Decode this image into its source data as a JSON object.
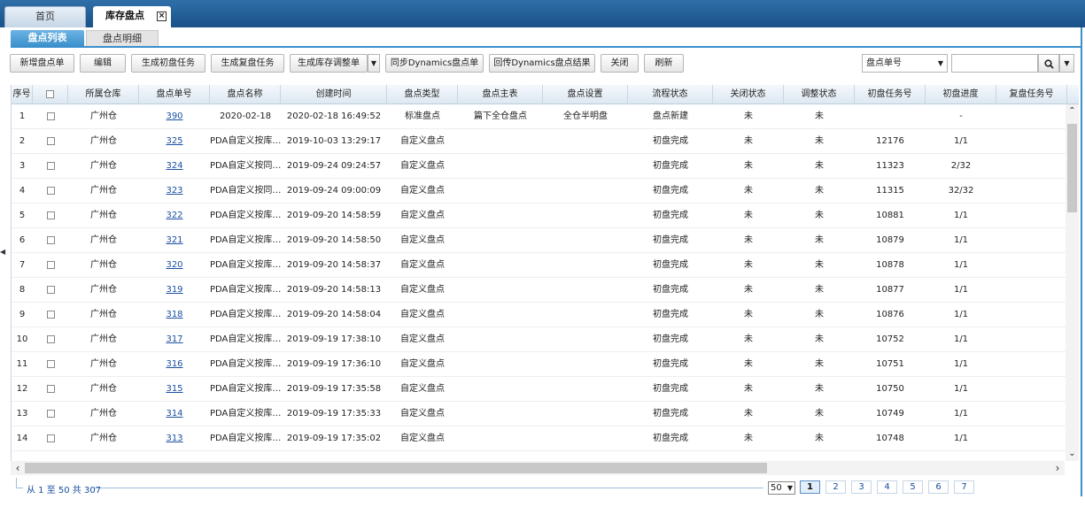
{
  "tabs": [
    {
      "label": "首页"
    },
    {
      "label": "库存盘点"
    }
  ],
  "subtabs": [
    {
      "label": "盘点列表"
    },
    {
      "label": "盘点明细"
    }
  ],
  "toolbar": {
    "buttons": [
      {
        "label": "新增盘点单"
      },
      {
        "label": "编辑"
      },
      {
        "label": "生成初盘任务"
      },
      {
        "label": "生成复盘任务"
      },
      {
        "label": "生成库存调整单"
      },
      {
        "label": "同步Dynamics盘点单"
      },
      {
        "label": "回传Dynamics盘点结果"
      },
      {
        "label": "关闭"
      },
      {
        "label": "刷新"
      }
    ],
    "search_field": "盘点单号",
    "search_value": ""
  },
  "grid": {
    "columns": [
      "序号",
      "",
      "所属仓库",
      "盘点单号",
      "盘点名称",
      "创建时间",
      "盘点类型",
      "盘点主表",
      "盘点设置",
      "流程状态",
      "关闭状态",
      "调整状态",
      "初盘任务号",
      "初盘进度",
      "复盘任务号"
    ],
    "rows": [
      {
        "seq": "1",
        "warehouse": "广州仓",
        "order_no": "390",
        "name": "2020-02-18",
        "created": "2020-02-18 16:49:52",
        "type": "标准盘点",
        "main": "篇下全仓盘点",
        "setting": "全仓半明盘",
        "flow": "盘点新建",
        "closed": "未",
        "adjust": "未",
        "task_no": "",
        "progress": "-",
        "recheck_no": ""
      },
      {
        "seq": "2",
        "warehouse": "广州仓",
        "order_no": "325",
        "name": "PDA自定义按库…",
        "created": "2019-10-03 13:29:17",
        "type": "自定义盘点",
        "main": "",
        "setting": "",
        "flow": "初盘完成",
        "closed": "未",
        "adjust": "未",
        "task_no": "12176",
        "progress": "1/1",
        "recheck_no": ""
      },
      {
        "seq": "3",
        "warehouse": "广州仓",
        "order_no": "324",
        "name": "PDA自定义按同…",
        "created": "2019-09-24 09:24:57",
        "type": "自定义盘点",
        "main": "",
        "setting": "",
        "flow": "初盘完成",
        "closed": "未",
        "adjust": "未",
        "task_no": "11323",
        "progress": "2/32",
        "recheck_no": ""
      },
      {
        "seq": "4",
        "warehouse": "广州仓",
        "order_no": "323",
        "name": "PDA自定义按同…",
        "created": "2019-09-24 09:00:09",
        "type": "自定义盘点",
        "main": "",
        "setting": "",
        "flow": "初盘完成",
        "closed": "未",
        "adjust": "未",
        "task_no": "11315",
        "progress": "32/32",
        "recheck_no": ""
      },
      {
        "seq": "5",
        "warehouse": "广州仓",
        "order_no": "322",
        "name": "PDA自定义按库…",
        "created": "2019-09-20 14:58:59",
        "type": "自定义盘点",
        "main": "",
        "setting": "",
        "flow": "初盘完成",
        "closed": "未",
        "adjust": "未",
        "task_no": "10881",
        "progress": "1/1",
        "recheck_no": ""
      },
      {
        "seq": "6",
        "warehouse": "广州仓",
        "order_no": "321",
        "name": "PDA自定义按库…",
        "created": "2019-09-20 14:58:50",
        "type": "自定义盘点",
        "main": "",
        "setting": "",
        "flow": "初盘完成",
        "closed": "未",
        "adjust": "未",
        "task_no": "10879",
        "progress": "1/1",
        "recheck_no": ""
      },
      {
        "seq": "7",
        "warehouse": "广州仓",
        "order_no": "320",
        "name": "PDA自定义按库…",
        "created": "2019-09-20 14:58:37",
        "type": "自定义盘点",
        "main": "",
        "setting": "",
        "flow": "初盘完成",
        "closed": "未",
        "adjust": "未",
        "task_no": "10878",
        "progress": "1/1",
        "recheck_no": ""
      },
      {
        "seq": "8",
        "warehouse": "广州仓",
        "order_no": "319",
        "name": "PDA自定义按库…",
        "created": "2019-09-20 14:58:13",
        "type": "自定义盘点",
        "main": "",
        "setting": "",
        "flow": "初盘完成",
        "closed": "未",
        "adjust": "未",
        "task_no": "10877",
        "progress": "1/1",
        "recheck_no": ""
      },
      {
        "seq": "9",
        "warehouse": "广州仓",
        "order_no": "318",
        "name": "PDA自定义按库…",
        "created": "2019-09-20 14:58:04",
        "type": "自定义盘点",
        "main": "",
        "setting": "",
        "flow": "初盘完成",
        "closed": "未",
        "adjust": "未",
        "task_no": "10876",
        "progress": "1/1",
        "recheck_no": ""
      },
      {
        "seq": "10",
        "warehouse": "广州仓",
        "order_no": "317",
        "name": "PDA自定义按库…",
        "created": "2019-09-19 17:38:10",
        "type": "自定义盘点",
        "main": "",
        "setting": "",
        "flow": "初盘完成",
        "closed": "未",
        "adjust": "未",
        "task_no": "10752",
        "progress": "1/1",
        "recheck_no": ""
      },
      {
        "seq": "11",
        "warehouse": "广州仓",
        "order_no": "316",
        "name": "PDA自定义按库…",
        "created": "2019-09-19 17:36:10",
        "type": "自定义盘点",
        "main": "",
        "setting": "",
        "flow": "初盘完成",
        "closed": "未",
        "adjust": "未",
        "task_no": "10751",
        "progress": "1/1",
        "recheck_no": ""
      },
      {
        "seq": "12",
        "warehouse": "广州仓",
        "order_no": "315",
        "name": "PDA自定义按库…",
        "created": "2019-09-19 17:35:58",
        "type": "自定义盘点",
        "main": "",
        "setting": "",
        "flow": "初盘完成",
        "closed": "未",
        "adjust": "未",
        "task_no": "10750",
        "progress": "1/1",
        "recheck_no": ""
      },
      {
        "seq": "13",
        "warehouse": "广州仓",
        "order_no": "314",
        "name": "PDA自定义按库…",
        "created": "2019-09-19 17:35:33",
        "type": "自定义盘点",
        "main": "",
        "setting": "",
        "flow": "初盘完成",
        "closed": "未",
        "adjust": "未",
        "task_no": "10749",
        "progress": "1/1",
        "recheck_no": ""
      },
      {
        "seq": "14",
        "warehouse": "广州仓",
        "order_no": "313",
        "name": "PDA自定义按库…",
        "created": "2019-09-19 17:35:02",
        "type": "自定义盘点",
        "main": "",
        "setting": "",
        "flow": "初盘完成",
        "closed": "未",
        "adjust": "未",
        "task_no": "10748",
        "progress": "1/1",
        "recheck_no": ""
      }
    ]
  },
  "footer": {
    "summary": "从 1 至 50 共 307",
    "page_size": "50",
    "pages": [
      "1",
      "2",
      "3",
      "4",
      "5",
      "6",
      "7"
    ],
    "current_page": "1"
  },
  "icons": {
    "close": "close-icon",
    "search": "search-icon",
    "dropdown": "chevron-down-icon"
  }
}
